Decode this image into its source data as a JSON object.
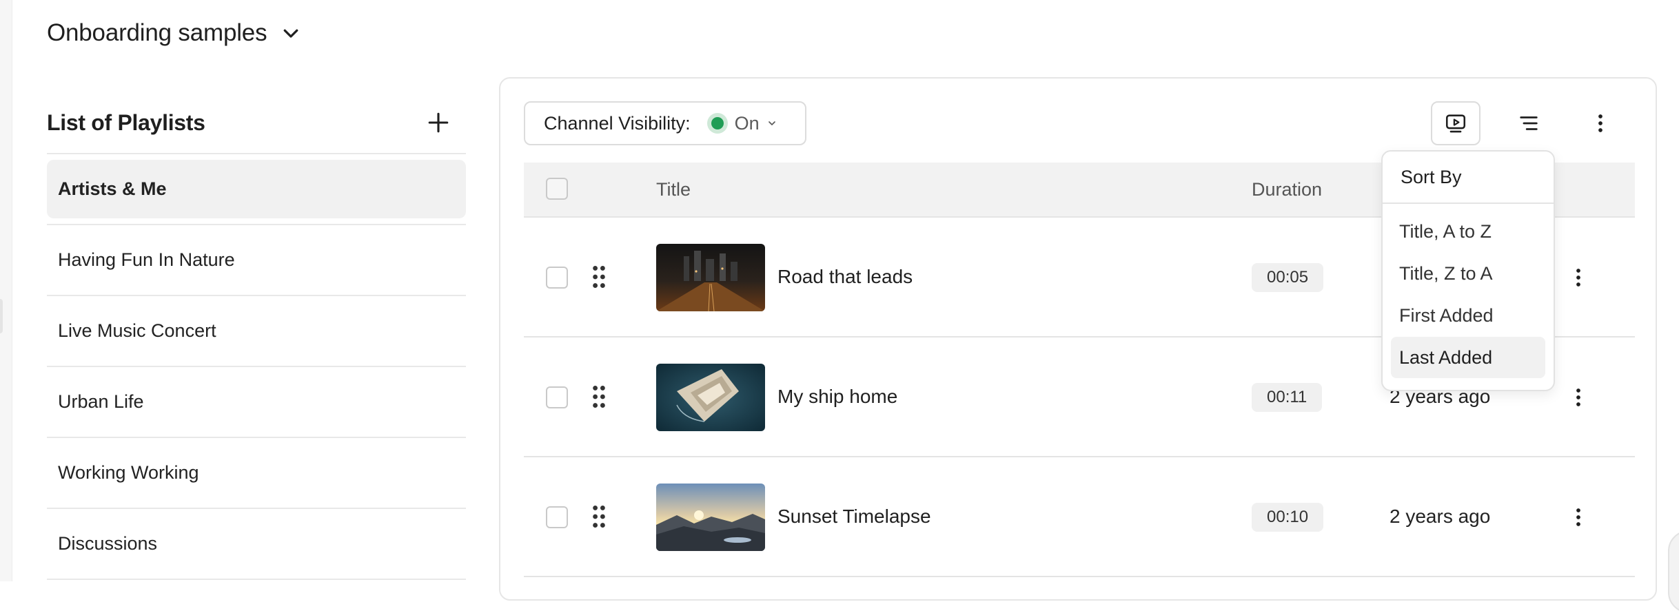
{
  "header": {
    "title": "Onboarding samples"
  },
  "sidebar": {
    "title": "List of Playlists",
    "items": [
      {
        "label": "Artists & Me",
        "active": true
      },
      {
        "label": "Having Fun In Nature"
      },
      {
        "label": "Live Music Concert"
      },
      {
        "label": "Urban Life"
      },
      {
        "label": "Working Working"
      },
      {
        "label": "Discussions"
      }
    ]
  },
  "toolbar": {
    "visibility_label": "Channel Visibility:",
    "visibility_state": "On",
    "visibility_color": "#1f9d55"
  },
  "table": {
    "columns": {
      "title": "Title",
      "duration": "Duration"
    },
    "rows": [
      {
        "title": "Road that leads",
        "duration": "00:05",
        "added": "",
        "thumb": "city-night"
      },
      {
        "title": "My ship home",
        "duration": "00:11",
        "added": "2 years ago",
        "thumb": "ship-aerial"
      },
      {
        "title": "Sunset Timelapse",
        "duration": "00:10",
        "added": "2 years ago",
        "thumb": "mountain-sunset"
      }
    ]
  },
  "sort_menu": {
    "title": "Sort By",
    "options": [
      "Title, A to Z",
      "Title, Z to A",
      "First Added",
      "Last Added"
    ],
    "selected": "Last Added"
  }
}
